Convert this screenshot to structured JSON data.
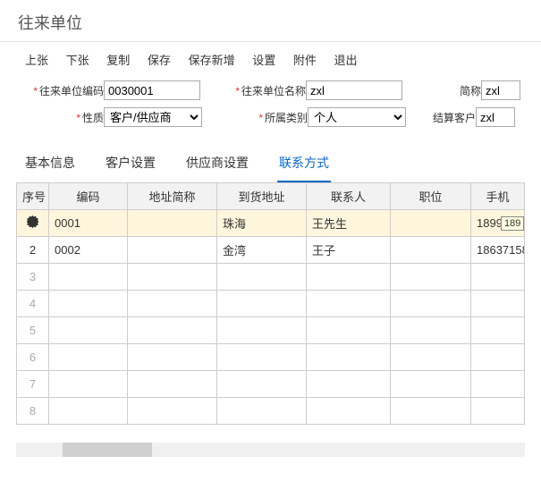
{
  "title": "往来单位",
  "toolbar": [
    "上张",
    "下张",
    "复制",
    "保存",
    "保存新增",
    "设置",
    "附件",
    "退出"
  ],
  "form": {
    "code_label": "往来单位编码",
    "code_value": "0030001",
    "name_label": "往来单位名称",
    "name_value": "zxl",
    "short_label": "简称",
    "short_value": "zxl",
    "nature_label": "性质",
    "nature_value": "客户/供应商",
    "cat_label": "所属类别",
    "cat_value": "个人",
    "settle_label": "结算客户",
    "settle_value": "zxl"
  },
  "tabs": [
    "基本信息",
    "客户设置",
    "供应商设置",
    "联系方式"
  ],
  "active_tab": 3,
  "columns": [
    "序号",
    "编码",
    "地址简称",
    "到货地址",
    "联系人",
    "职位",
    "手机"
  ],
  "rows": [
    {
      "num": "",
      "gear": true,
      "code": "0001",
      "addr": "",
      "ship": "珠海",
      "contact": "王先生",
      "pos": "",
      "phone": "1899"
    },
    {
      "num": "2",
      "code": "0002",
      "addr": "",
      "ship": "金湾",
      "contact": "王子",
      "pos": "",
      "phone": "18637158"
    }
  ],
  "empty_rows": [
    3,
    4,
    5,
    6,
    7,
    8
  ],
  "tooltip": "189"
}
